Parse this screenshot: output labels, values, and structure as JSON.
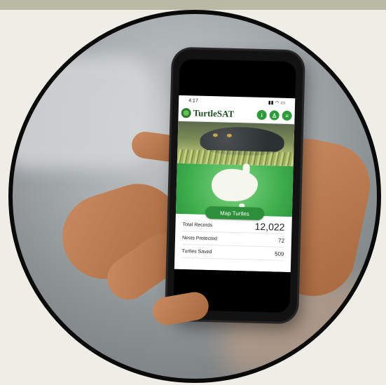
{
  "phone": {
    "status_time": "4:17",
    "status_icons": "signal-wifi-battery-icons",
    "app": {
      "brand": "TurtleSAT",
      "header_icons": [
        "info-icon",
        "user-icon",
        "menu-icon"
      ],
      "header_icon_glyphs": [
        "i",
        "♙",
        "≡"
      ],
      "map_button_label": "Map Turtles",
      "stats": [
        {
          "label": "Total Records",
          "value": "12,022"
        },
        {
          "label": "Nests Protected",
          "value": "72"
        },
        {
          "label": "Turtles Saved",
          "value": "509"
        }
      ]
    }
  },
  "colors": {
    "accent_green": "#2e9a3c",
    "brand_dark_green": "#1f4d22",
    "frame_black": "#0a0a0a"
  }
}
